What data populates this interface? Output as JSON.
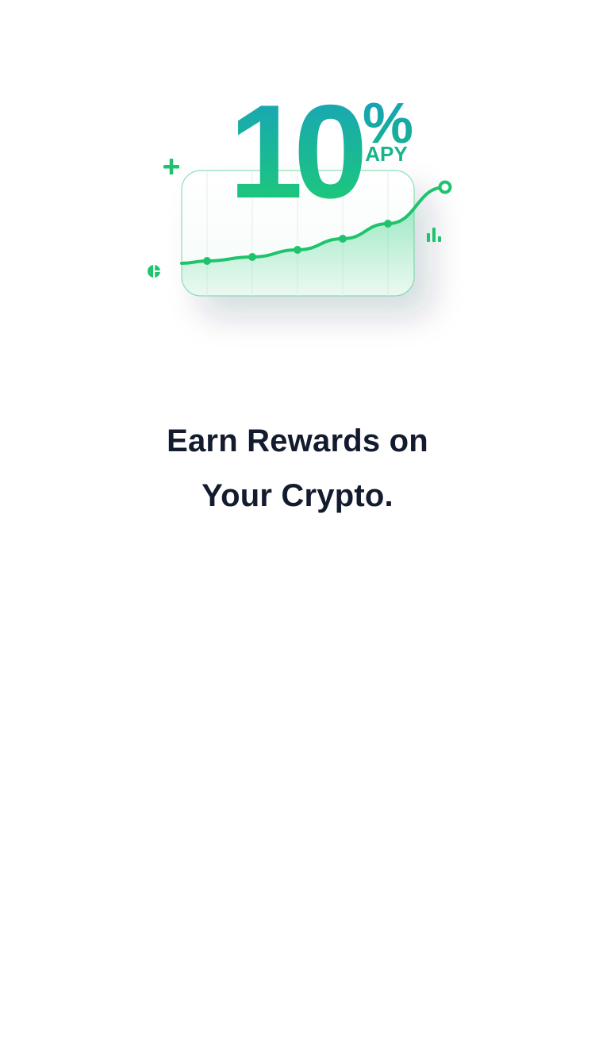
{
  "hero": {
    "rate_number": "10",
    "rate_symbol": "%",
    "rate_unit": "APY",
    "icons": [
      "plus-icon",
      "pie-chart-icon",
      "bar-chart-icon"
    ]
  },
  "chart_data": {
    "type": "line",
    "series": [
      {
        "values": [
          0.5,
          1.0,
          1.9,
          3.3,
          5.2,
          9.8
        ]
      }
    ]
  },
  "headline": {
    "line1": "Earn Rewards on",
    "line2": "Your Crypto."
  },
  "colors": {
    "accent_green": "#1ec46d",
    "accent_teal": "#179fb8",
    "headline": "#131b2e",
    "background": "#ffffff"
  }
}
